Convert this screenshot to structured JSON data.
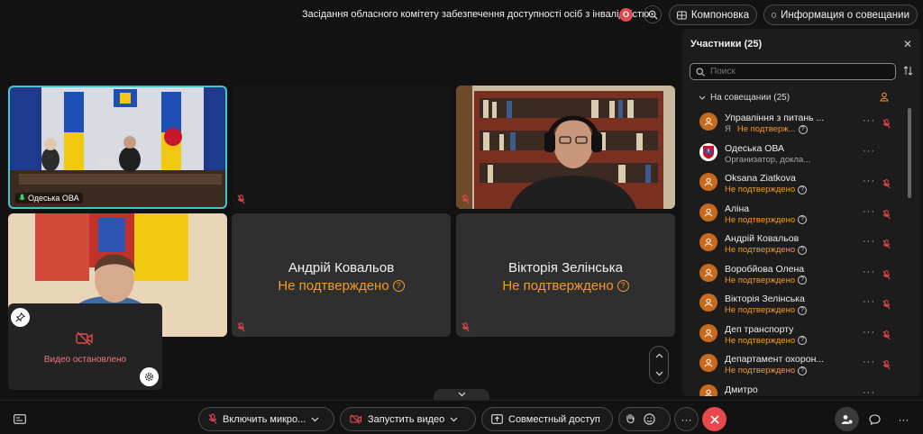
{
  "header": {
    "meeting_title": "Засідання обласного комітету забезпечення доступності осіб з інвалідністю",
    "rec_label": "O",
    "layout_label": "Компоновка",
    "info_label": "Информация о совещании"
  },
  "tiles": [
    {
      "label": "Одеська ОВА"
    },
    {
      "label": ""
    },
    {
      "label": ""
    },
    {
      "label": ""
    },
    {
      "name": "Андрій Ковальов",
      "status": "Не подтверждено"
    },
    {
      "name": "Вікторія Зелінська",
      "status": "Не подтверждено"
    }
  ],
  "selfview": {
    "text": "Видео остановлено"
  },
  "participants": {
    "title": "Участники (25)",
    "search_placeholder": "Поиск",
    "group_label": "На совещании (25)",
    "items": [
      {
        "name": "Управління з питань ...",
        "me": "Я",
        "status": "Не подтверж...",
        "grey": false
      },
      {
        "name": "Одеська ОВА",
        "status": "Организатор, докла...",
        "grey": true
      },
      {
        "name": "Oksana Ziatkova",
        "status": "Не подтверждено",
        "grey": false
      },
      {
        "name": "Аліна",
        "status": "Не подтверждено",
        "grey": false
      },
      {
        "name": "Андрій Ковальов",
        "status": "Не подтверждено",
        "grey": false
      },
      {
        "name": "Воробйова Олена",
        "status": "Не подтверждено",
        "grey": false
      },
      {
        "name": "Вікторія Зелінська",
        "status": "Не подтверждено",
        "grey": false
      },
      {
        "name": "Деп транспорту",
        "status": "Не подтверждено",
        "grey": false
      },
      {
        "name": "Департамент охорон...",
        "status": "Не подтверждено",
        "grey": false
      },
      {
        "name": "Дмитро",
        "status": "",
        "grey": false
      }
    ]
  },
  "bottombar": {
    "mic_label": "Включить микро...",
    "video_label": "Запустить видео",
    "share_label": "Совместный доступ",
    "more_label": "···"
  },
  "colors": {
    "accent_orange": "#f59a23",
    "end_red": "#e5484d",
    "selected_border": "#3fc7d1"
  }
}
